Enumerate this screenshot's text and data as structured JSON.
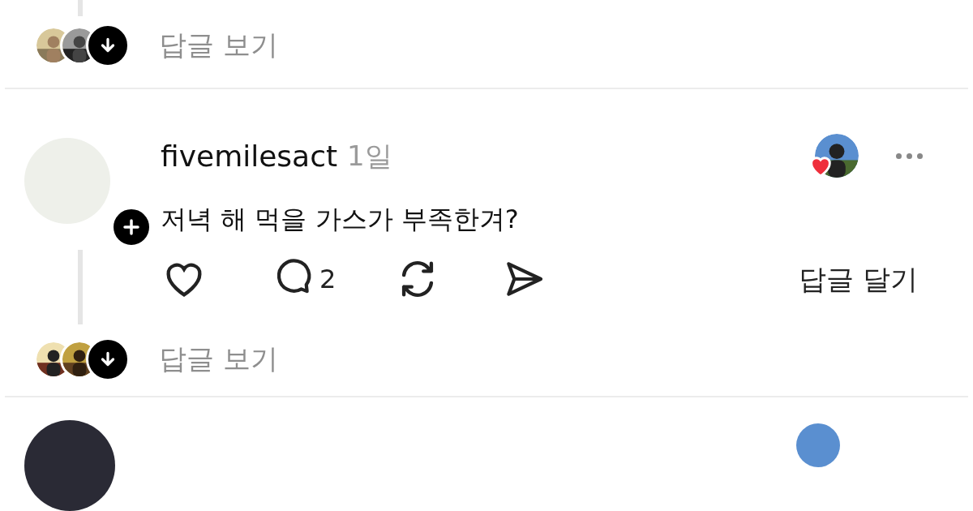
{
  "top_replies": {
    "label": "답글 보기"
  },
  "comment": {
    "username": "fivemilesact",
    "time": "1일",
    "text": "저녁 해 먹을 가스가 부족한겨?",
    "liked": false,
    "reply_count": "2",
    "reply_button": "답글 달기"
  },
  "replies": {
    "label": "답글 보기"
  }
}
